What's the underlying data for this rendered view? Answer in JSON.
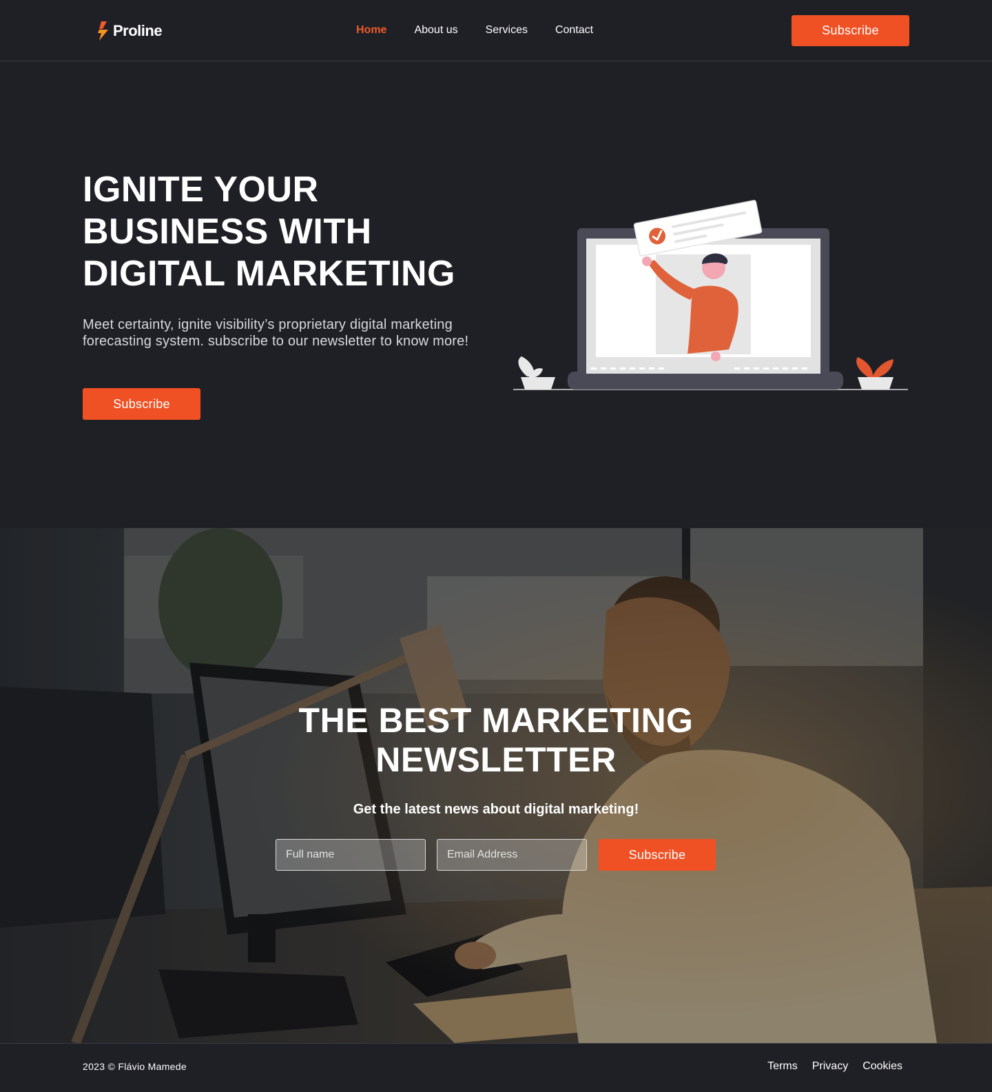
{
  "brand": {
    "name": "Proline",
    "accent_color": "#ef5124",
    "background_color": "#1f2026"
  },
  "header": {
    "nav": [
      {
        "label": "Home",
        "active": true
      },
      {
        "label": "About us",
        "active": false
      },
      {
        "label": "Services",
        "active": false
      },
      {
        "label": "Contact",
        "active": false
      }
    ],
    "subscribe_label": "Subscribe"
  },
  "hero": {
    "title_lines": [
      "IGNITE YOUR",
      "BUSINESS WITH",
      "DIGITAL MARKETING"
    ],
    "text": "Meet certainty, ignite visibility’s proprietary digital marketing forecasting system. subscribe to our newsletter to know more!",
    "button_label": "Subscribe",
    "illustration_icon": "laptop-person-checkmark-illustration"
  },
  "newsletter": {
    "background_icon": "man-working-at-computer-photo",
    "title_lines": [
      "THE BEST MARKETING",
      "NEWSLETTER"
    ],
    "subtitle": "Get the latest news about digital marketing!",
    "name_placeholder": "Full name",
    "email_placeholder": "Email Address",
    "button_label": "Subscribe"
  },
  "footer": {
    "copyright": "2023 © Flávio Mamede",
    "links": [
      "Terms",
      "Privacy",
      "Cookies"
    ]
  }
}
